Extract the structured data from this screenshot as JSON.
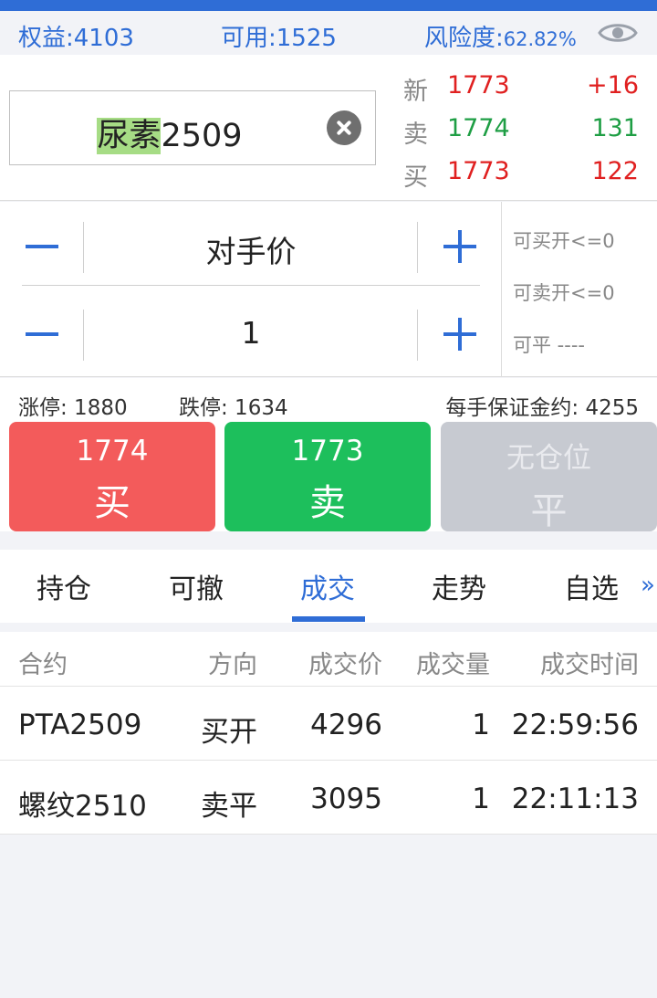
{
  "account": {
    "equity_label": "权益: ",
    "equity_value": "4103",
    "available_label": "可用: ",
    "available_value": "1525",
    "risk_label": "风险度: ",
    "risk_value": "62.82%"
  },
  "contract": {
    "name_highlight": "尿素",
    "code": "2509"
  },
  "quote": {
    "last": {
      "label": "新",
      "price": "1773",
      "change": "+16"
    },
    "ask": {
      "label": "卖",
      "price": "1774",
      "volume": "131"
    },
    "bid": {
      "label": "买",
      "price": "1773",
      "volume": "122"
    }
  },
  "order": {
    "price_mode": "对手价",
    "quantity": "1",
    "can_buy_open": "可买开<=0",
    "can_sell_open": "可卖开<=0",
    "can_close": "可平 ----"
  },
  "limits": {
    "limit_up": "涨停: 1880",
    "limit_down": "跌停: 1634",
    "margin": "每手保证金约: 4255"
  },
  "actions": {
    "buy": {
      "price": "1774",
      "label": "买"
    },
    "sell": {
      "price": "1773",
      "label": "卖"
    },
    "close": {
      "price": "无仓位",
      "label": "平"
    }
  },
  "tabs": {
    "items": [
      "持仓",
      "可撤",
      "成交",
      "走势",
      "自选"
    ],
    "active": "成交",
    "more": "»"
  },
  "trades": {
    "headers": [
      "合约",
      "方向",
      "成交价",
      "成交量",
      "成交时间"
    ],
    "rows": [
      {
        "contract": "PTA2509",
        "direction": "买开",
        "price": "4296",
        "volume": "1",
        "time": "22:59:56"
      },
      {
        "contract": "螺纹2510",
        "direction": "卖平",
        "price": "3095",
        "volume": "1",
        "time": "22:11:13"
      }
    ]
  },
  "colors": {
    "accent": "#2f6dd6",
    "up": "#e02020",
    "down": "#1e9e44",
    "buy_button": "#f35b5b",
    "sell_button": "#1dbf5c",
    "disabled_button": "#c7cad1"
  },
  "icons": {
    "visibility": "eye-icon",
    "clear": "clear-icon",
    "decrease": "minus-icon",
    "increase": "plus-icon",
    "more": "double-chevron-right-icon"
  }
}
